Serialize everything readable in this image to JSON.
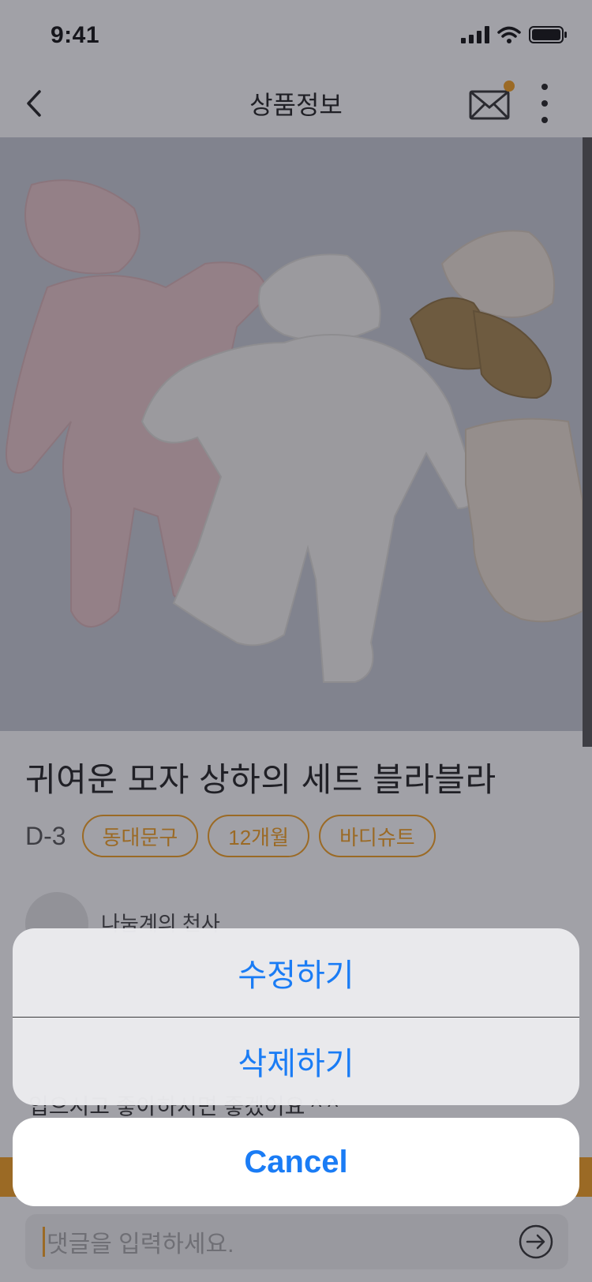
{
  "status_bar": {
    "time": "9:41"
  },
  "nav": {
    "title": "상품정보"
  },
  "product": {
    "title": "귀여운 모자 상하의 세트 블라블라",
    "d_day": "D-3",
    "tags": [
      "동대문구",
      "12개월",
      "바디슈트"
    ],
    "seller_name": "나눔계의 천사",
    "description": "입으시고 좋아하시면 좋겠어요 ^ ^"
  },
  "comment": {
    "placeholder": "댓글을 입력하세요."
  },
  "action_sheet": {
    "edit_label": "수정하기",
    "delete_label": "삭제하기",
    "cancel_label": "Cancel"
  },
  "colors": {
    "accent": "#f4a01f",
    "action_blue": "#1a7cf5"
  }
}
